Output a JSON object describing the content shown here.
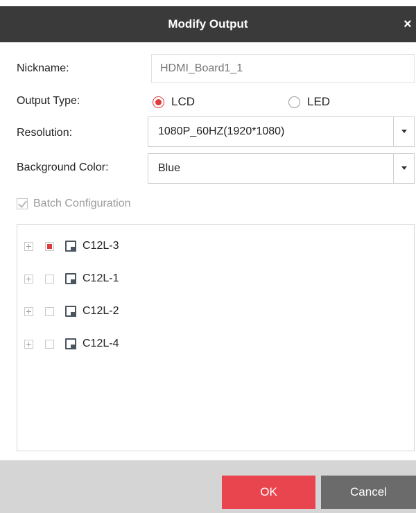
{
  "dialog": {
    "title": "Modify Output",
    "close_glyph": "×"
  },
  "form": {
    "nickname": {
      "label": "Nickname:",
      "placeholder": "HDMI_Board1_1"
    },
    "output_type": {
      "label": "Output Type:",
      "options": [
        {
          "label": "LCD",
          "selected": true
        },
        {
          "label": "LED",
          "selected": false
        }
      ]
    },
    "resolution": {
      "label": "Resolution:",
      "value": "1080P_60HZ(1920*1080)"
    },
    "background_color": {
      "label": "Background Color:",
      "value": "Blue"
    },
    "batch_configuration": {
      "label": "Batch Configuration",
      "checked": true,
      "disabled": true
    }
  },
  "tree": {
    "nodes": [
      {
        "label": "C12L-3",
        "check_state": "partial",
        "icon": "monitor-icon"
      },
      {
        "label": "C12L-1",
        "check_state": "unchecked",
        "icon": "monitor-icon"
      },
      {
        "label": "C12L-2",
        "check_state": "unchecked",
        "icon": "monitor-icon"
      },
      {
        "label": "C12L-4",
        "check_state": "unchecked",
        "icon": "monitor-icon"
      }
    ]
  },
  "buttons": {
    "ok": "OK",
    "cancel": "Cancel"
  },
  "colors": {
    "titlebar": "#3a3a3a",
    "accent_red": "#e03a3a",
    "ok_button": "#e8454f",
    "cancel_button": "#6b6b6b",
    "footer": "#d5d5d5"
  }
}
